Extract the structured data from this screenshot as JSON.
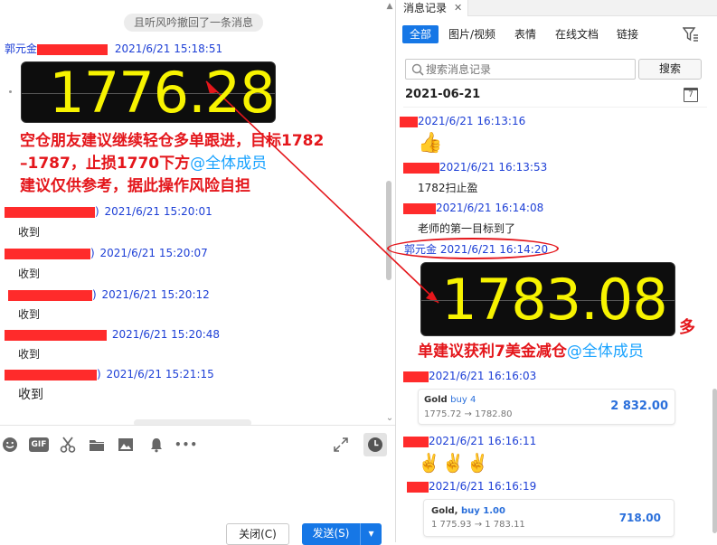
{
  "left_chat": {
    "system_notice": "且听风吟撤回了一条消息",
    "messages": [
      {
        "sender": "郭元金",
        "time": "2021/6/21 15:18:51"
      },
      {
        "time": "2021/6/21 15:20:01",
        "body": "收到"
      },
      {
        "time": "2021/6/21 15:20:07",
        "body": "收到"
      },
      {
        "time": "2021/6/21 15:20:12",
        "body": "收到"
      },
      {
        "time": "2021/6/21 15:20:48",
        "body": "收到"
      },
      {
        "time": "2021/6/21 15:21:15",
        "body": "收到"
      }
    ],
    "ticker_value": "1776.28",
    "advice_line1": "空仓朋友建议继续轻仓多单跟进，目标1782",
    "advice_line2": "–1787，止损1770下方",
    "advice_mention": "@全体成员",
    "advice_line3": "建议仅供参考，据此操作风险自担"
  },
  "toolbar": {
    "icons": [
      "emoji-icon",
      "gif-icon",
      "scissors-icon",
      "folder-icon",
      "image-icon",
      "bell-icon",
      "more-icon",
      "expand-icon",
      "history-icon"
    ],
    "gif_label": "GIF",
    "more_label": "•••",
    "close_label": "关闭(C)",
    "send_label": "发送(S)",
    "send_dropdown": "▾"
  },
  "right_panel": {
    "tab_title": "消息记录",
    "tab_close": "✕",
    "filters": [
      "全部",
      "图片/视频",
      "表情",
      "在线文档",
      "链接"
    ],
    "search_placeholder": "搜索消息记录",
    "search_button": "搜索",
    "date": "2021-06-21",
    "calendar_day": "7",
    "records": [
      {
        "time": "2021/6/21 16:13:16",
        "emoji": "👍"
      },
      {
        "time": "2021/6/21 16:13:53",
        "body": "1782扫止盈"
      },
      {
        "time": "2021/6/21 16:14:08",
        "body": "老师的第一目标到了"
      },
      {
        "sender": "郭元金",
        "time": "2021/6/21 16:14:20"
      },
      {
        "time": "2021/6/21 16:16:03"
      },
      {
        "time": "2021/6/21 16:16:11",
        "emoji": "✌️✌️✌️"
      },
      {
        "time": "2021/6/21 16:16:19"
      }
    ],
    "ticker_value": "1783.08",
    "profit_line1": "多",
    "profit_line2": "单建议获利7美金减仓",
    "profit_mention": "@全体成员",
    "trade1": {
      "title": "Gold",
      "side": "buy 4",
      "range": "1775.72 → 1782.80",
      "profit": "2 832.00"
    },
    "trade2": {
      "title": "Gold,",
      "side": "buy 1.00",
      "range": "1 775.93 → 1 783.11",
      "profit": "718.00"
    }
  },
  "colors": {
    "accent": "#1677e6",
    "mention": "#1aa3ff",
    "annotation_red": "#e4161b",
    "ticker_digits": "#f7f300"
  }
}
